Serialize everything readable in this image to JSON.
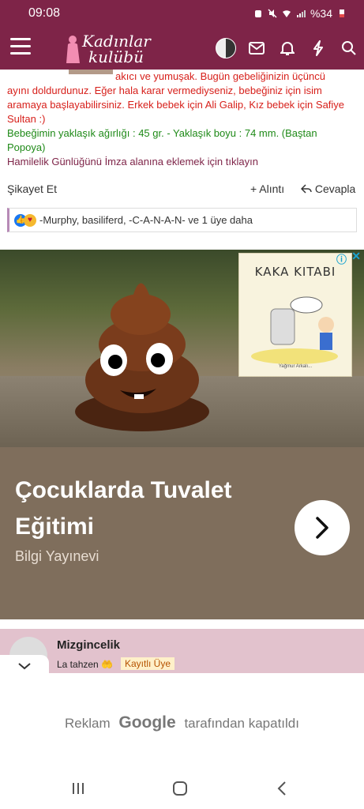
{
  "status_bar": {
    "time": "09:08",
    "battery": "%34"
  },
  "app_bar": {
    "logo_line1": "Kadınlar",
    "logo_line2": "kulübü"
  },
  "post": {
    "line_red_1": "akıcı ve yumuşak. Bugün gebeliğinizin üçüncü",
    "line_red_2": "ayını doldurdunuz. Eğer hala karar vermediyseniz, bebeğiniz için isim aramaya başlayabilirsiniz. Erkek bebek için Ali Galip, Kız bebek için Safiye Sultan :)",
    "line_green": "Bebeğimin yaklaşık ağırlığı : 45 gr. - Yaklaşık boyu : 74 mm. (Baştan Popoya)",
    "line_maroon": "Hamilelik Günlüğünü İmza alanına eklemek için tıklayın"
  },
  "actions": {
    "complain": "Şikayet Et",
    "quote": "+ Alıntı",
    "reply": "Cevapla"
  },
  "reactions": {
    "text": "-Murphy, basiliferd, -C-A-N-A-N- ve 1 üye daha"
  },
  "ad": {
    "book_title": "KAKA KITABI",
    "book_small": "Yağmur Arkalı...",
    "headline": "Çocuklarda Tuvalet Eğitimi",
    "brand": "Bilgi Yayınevi"
  },
  "next_post": {
    "username": "Mizgincelik",
    "title": "La tahzen 🤲",
    "badge": "Kayıtlı Üye"
  },
  "ad_closed": {
    "before": "Reklam",
    "google": "Google",
    "after": "tarafından kapatıldı"
  }
}
